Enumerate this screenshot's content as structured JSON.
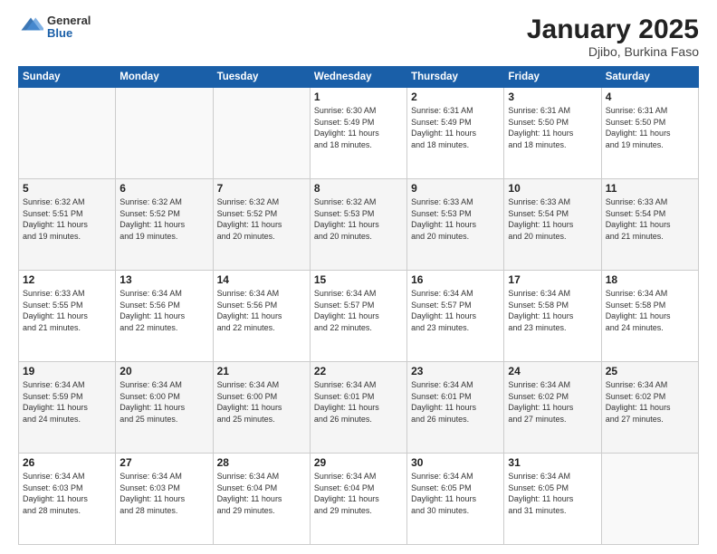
{
  "logo": {
    "general": "General",
    "blue": "Blue"
  },
  "title": "January 2025",
  "location": "Djibo, Burkina Faso",
  "weekdays": [
    "Sunday",
    "Monday",
    "Tuesday",
    "Wednesday",
    "Thursday",
    "Friday",
    "Saturday"
  ],
  "weeks": [
    [
      {
        "day": "",
        "info": ""
      },
      {
        "day": "",
        "info": ""
      },
      {
        "day": "",
        "info": ""
      },
      {
        "day": "1",
        "info": "Sunrise: 6:30 AM\nSunset: 5:49 PM\nDaylight: 11 hours\nand 18 minutes."
      },
      {
        "day": "2",
        "info": "Sunrise: 6:31 AM\nSunset: 5:49 PM\nDaylight: 11 hours\nand 18 minutes."
      },
      {
        "day": "3",
        "info": "Sunrise: 6:31 AM\nSunset: 5:50 PM\nDaylight: 11 hours\nand 18 minutes."
      },
      {
        "day": "4",
        "info": "Sunrise: 6:31 AM\nSunset: 5:50 PM\nDaylight: 11 hours\nand 19 minutes."
      }
    ],
    [
      {
        "day": "5",
        "info": "Sunrise: 6:32 AM\nSunset: 5:51 PM\nDaylight: 11 hours\nand 19 minutes."
      },
      {
        "day": "6",
        "info": "Sunrise: 6:32 AM\nSunset: 5:52 PM\nDaylight: 11 hours\nand 19 minutes."
      },
      {
        "day": "7",
        "info": "Sunrise: 6:32 AM\nSunset: 5:52 PM\nDaylight: 11 hours\nand 20 minutes."
      },
      {
        "day": "8",
        "info": "Sunrise: 6:32 AM\nSunset: 5:53 PM\nDaylight: 11 hours\nand 20 minutes."
      },
      {
        "day": "9",
        "info": "Sunrise: 6:33 AM\nSunset: 5:53 PM\nDaylight: 11 hours\nand 20 minutes."
      },
      {
        "day": "10",
        "info": "Sunrise: 6:33 AM\nSunset: 5:54 PM\nDaylight: 11 hours\nand 20 minutes."
      },
      {
        "day": "11",
        "info": "Sunrise: 6:33 AM\nSunset: 5:54 PM\nDaylight: 11 hours\nand 21 minutes."
      }
    ],
    [
      {
        "day": "12",
        "info": "Sunrise: 6:33 AM\nSunset: 5:55 PM\nDaylight: 11 hours\nand 21 minutes."
      },
      {
        "day": "13",
        "info": "Sunrise: 6:34 AM\nSunset: 5:56 PM\nDaylight: 11 hours\nand 22 minutes."
      },
      {
        "day": "14",
        "info": "Sunrise: 6:34 AM\nSunset: 5:56 PM\nDaylight: 11 hours\nand 22 minutes."
      },
      {
        "day": "15",
        "info": "Sunrise: 6:34 AM\nSunset: 5:57 PM\nDaylight: 11 hours\nand 22 minutes."
      },
      {
        "day": "16",
        "info": "Sunrise: 6:34 AM\nSunset: 5:57 PM\nDaylight: 11 hours\nand 23 minutes."
      },
      {
        "day": "17",
        "info": "Sunrise: 6:34 AM\nSunset: 5:58 PM\nDaylight: 11 hours\nand 23 minutes."
      },
      {
        "day": "18",
        "info": "Sunrise: 6:34 AM\nSunset: 5:58 PM\nDaylight: 11 hours\nand 24 minutes."
      }
    ],
    [
      {
        "day": "19",
        "info": "Sunrise: 6:34 AM\nSunset: 5:59 PM\nDaylight: 11 hours\nand 24 minutes."
      },
      {
        "day": "20",
        "info": "Sunrise: 6:34 AM\nSunset: 6:00 PM\nDaylight: 11 hours\nand 25 minutes."
      },
      {
        "day": "21",
        "info": "Sunrise: 6:34 AM\nSunset: 6:00 PM\nDaylight: 11 hours\nand 25 minutes."
      },
      {
        "day": "22",
        "info": "Sunrise: 6:34 AM\nSunset: 6:01 PM\nDaylight: 11 hours\nand 26 minutes."
      },
      {
        "day": "23",
        "info": "Sunrise: 6:34 AM\nSunset: 6:01 PM\nDaylight: 11 hours\nand 26 minutes."
      },
      {
        "day": "24",
        "info": "Sunrise: 6:34 AM\nSunset: 6:02 PM\nDaylight: 11 hours\nand 27 minutes."
      },
      {
        "day": "25",
        "info": "Sunrise: 6:34 AM\nSunset: 6:02 PM\nDaylight: 11 hours\nand 27 minutes."
      }
    ],
    [
      {
        "day": "26",
        "info": "Sunrise: 6:34 AM\nSunset: 6:03 PM\nDaylight: 11 hours\nand 28 minutes."
      },
      {
        "day": "27",
        "info": "Sunrise: 6:34 AM\nSunset: 6:03 PM\nDaylight: 11 hours\nand 28 minutes."
      },
      {
        "day": "28",
        "info": "Sunrise: 6:34 AM\nSunset: 6:04 PM\nDaylight: 11 hours\nand 29 minutes."
      },
      {
        "day": "29",
        "info": "Sunrise: 6:34 AM\nSunset: 6:04 PM\nDaylight: 11 hours\nand 29 minutes."
      },
      {
        "day": "30",
        "info": "Sunrise: 6:34 AM\nSunset: 6:05 PM\nDaylight: 11 hours\nand 30 minutes."
      },
      {
        "day": "31",
        "info": "Sunrise: 6:34 AM\nSunset: 6:05 PM\nDaylight: 11 hours\nand 31 minutes."
      },
      {
        "day": "",
        "info": ""
      }
    ]
  ]
}
